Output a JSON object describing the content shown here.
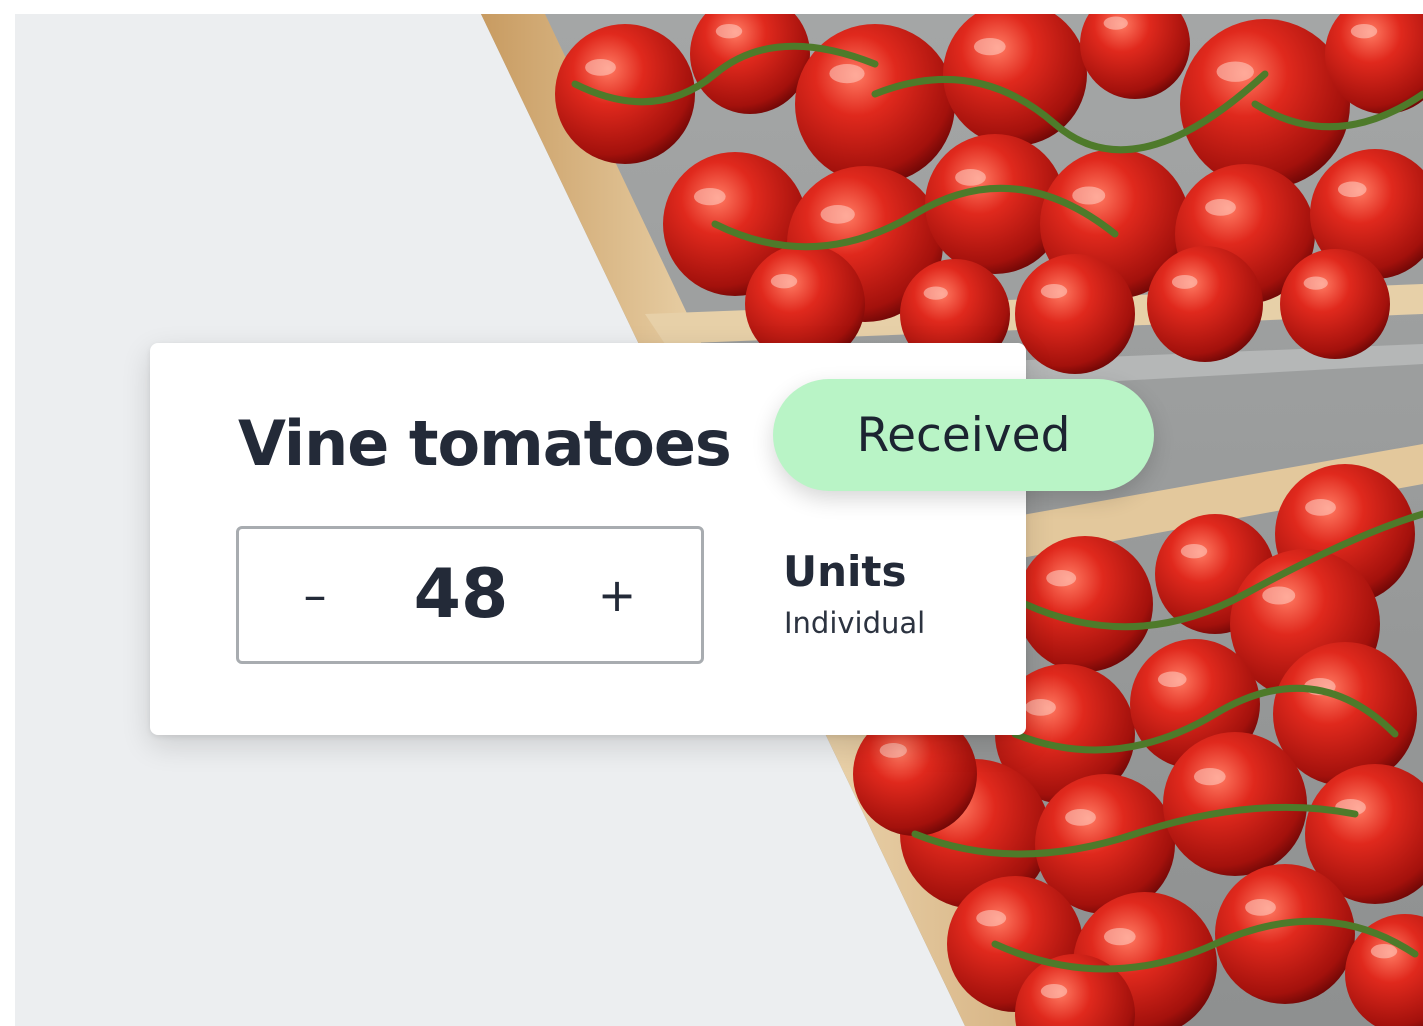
{
  "product": {
    "name": "Vine tomatoes",
    "status": "Received",
    "status_color": "#b9f4c6"
  },
  "quantity": {
    "decrement_label": "–",
    "value": "48",
    "increment_label": "+",
    "unit": "Units",
    "unit_type": "Individual"
  },
  "colors": {
    "background": "#eceef0",
    "text": "#232a38",
    "tomato": "#d8261c",
    "crate": "#e8cfa6"
  }
}
